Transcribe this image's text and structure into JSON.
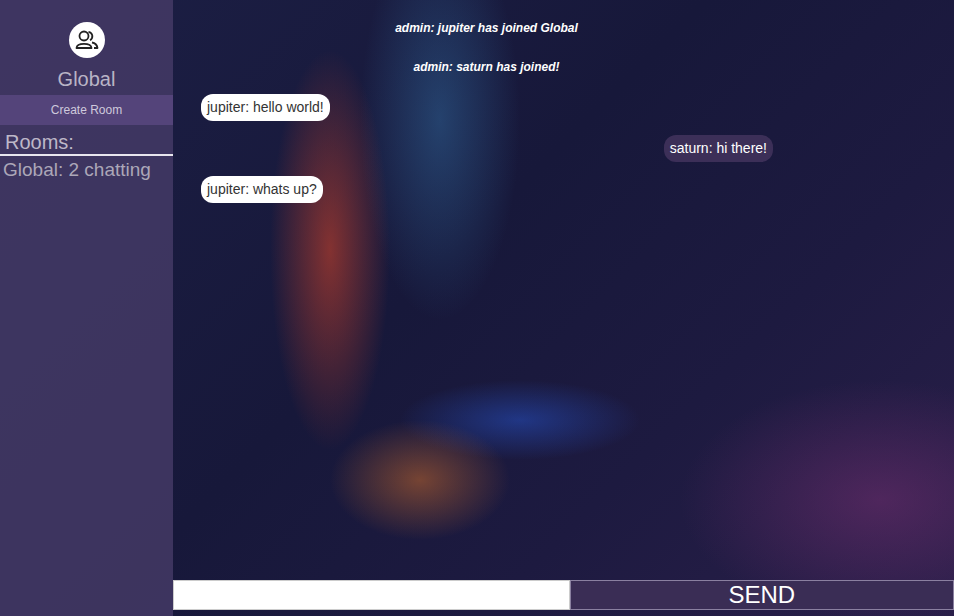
{
  "sidebar": {
    "room_title": "Global",
    "create_button": "Create Room",
    "rooms_label": "Rooms:",
    "rooms": [
      {
        "label": "Global: 2 chatting"
      }
    ]
  },
  "messages": [
    {
      "kind": "system",
      "text": "admin: jupiter has joined Global"
    },
    {
      "kind": "system",
      "text": "admin: saturn has joined!"
    },
    {
      "kind": "incoming",
      "text": "jupiter: hello world!"
    },
    {
      "kind": "outgoing",
      "text": "saturn: hi there!"
    },
    {
      "kind": "incoming",
      "text": "jupiter: whats up?"
    }
  ],
  "composer": {
    "value": "",
    "button": "SEND"
  }
}
